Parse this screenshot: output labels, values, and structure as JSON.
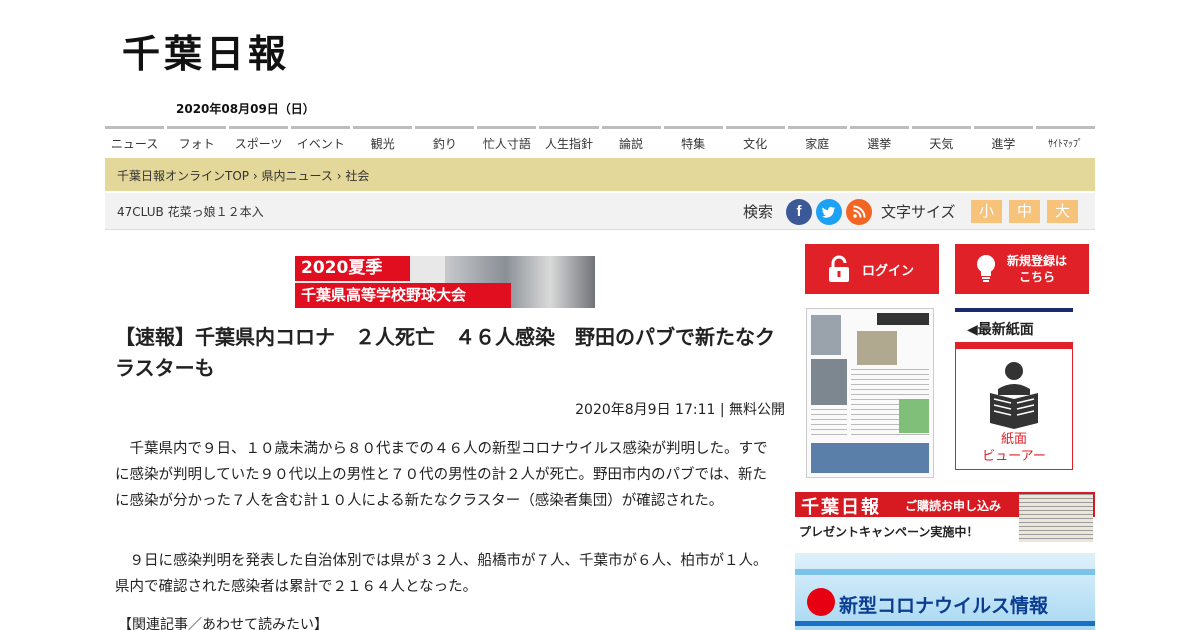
{
  "site": {
    "logo_text": "千葉日報",
    "date": "2020年08月09日（日）"
  },
  "nav": {
    "items": [
      "ニュース",
      "フォト",
      "スポーツ",
      "イベント",
      "観光",
      "釣り",
      "忙人寸語",
      "人生指針",
      "論説",
      "特集",
      "文化",
      "家庭",
      "選挙",
      "天気",
      "進学",
      "ｻｲﾄﾏｯﾌﾟ"
    ]
  },
  "breadcrumb": {
    "items": [
      "千葉日報オンラインTOP",
      "県内ニュース",
      "社会"
    ],
    "separator": "›"
  },
  "subbar": {
    "ticker": "47CLUB 花菜っ娘１２本入",
    "search_label": "検索",
    "social_icons": [
      "facebook-icon",
      "twitter-icon",
      "rss-icon"
    ],
    "font_size_label": "文字サイズ",
    "font_sizes": [
      "小",
      "中",
      "大"
    ]
  },
  "banner": {
    "line1": "2020夏季",
    "line2": "千葉県高等学校野球大会"
  },
  "article": {
    "headline": "【速報】千葉県内コロナ　２人死亡　４６人感染　野田のパブで新たなクラスターも",
    "meta": "2020年8月9日 17:11 | 無料公開",
    "paragraphs": [
      "千葉県内で９日、１０歳未満から８０代までの４６人の新型コロナウイルス感染が判明した。すでに感染が判明していた９０代以上の男性と７０代の男性の計２人が死亡。野田市内のパブでは、新たに感染が分かった７人を含む計１０人による新たなクラスター（感染者集団）が確認された。",
      "９日に感染判明を発表した自治体別では県が３２人、船橋市が７人、千葉市が６人、柏市が１人。県内で確認された感染者は累計で２１６４人となった。"
    ],
    "related_label": "【関連記事／あわせて読みたい】"
  },
  "sidebar": {
    "login_label": "ログイン",
    "register_label_1": "新規登録は",
    "register_label_2": "こちら",
    "latest_label": "◀最新紙面",
    "viewer_label_1": "紙面",
    "viewer_label_2": "ビューアー",
    "subscribe_logo": "千葉日報",
    "subscribe_cta": "ご購読お申し込み",
    "subscribe_campaign": "プレゼントキャンペーン実施中！",
    "corona_label": "新型コロナウイルス情報"
  },
  "colors": {
    "accent_red": "#e02127",
    "breadcrumb_bg": "#e3d79a",
    "fontsize_btn": "#f7c27a",
    "navy": "#1a2a6c"
  }
}
